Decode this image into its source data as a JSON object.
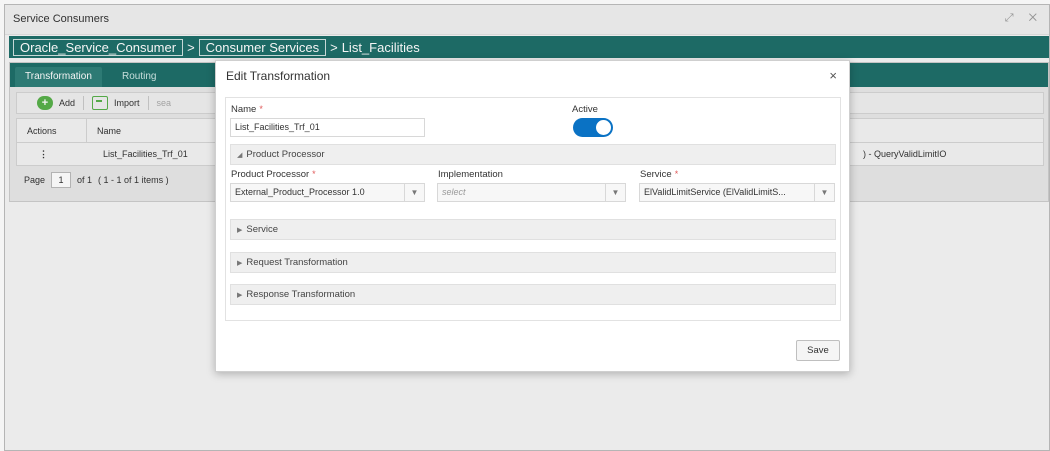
{
  "window": {
    "title": "Service Consumers",
    "controls": "⤢ ✕"
  },
  "breadcrumb": {
    "items": [
      "Oracle_Service_Consumer",
      "Consumer Services",
      "List_Facilities"
    ],
    "separator": ">"
  },
  "tabs": [
    {
      "label": "Transformation",
      "active": true
    },
    {
      "label": "Routing",
      "active": false
    }
  ],
  "toolbar": {
    "add_label": "Add",
    "import_label": "Import",
    "search_stub": "sea"
  },
  "grid": {
    "columns": [
      "Actions",
      "Name"
    ],
    "rows": [
      {
        "actions": "⋮",
        "name": "List_Facilities_Trf_01",
        "trailing": ") - QueryValidLimitIO"
      }
    ]
  },
  "pager": {
    "page_label": "Page",
    "page_value": "1",
    "of_label": "of 1",
    "range_label": "( 1 - 1 of 1 items )"
  },
  "modal": {
    "title": "Edit Transformation",
    "close": "×",
    "name_label": "Name",
    "required_mark": "*",
    "name_value": "List_Facilities_Trf_01",
    "active_label": "Active",
    "active": true,
    "product_processor_section": "Product Processor",
    "product_processor_label": "Product Processor",
    "product_processor_value": "External_Product_Processor 1.0",
    "implementation_label": "Implementation",
    "implementation_placeholder": "select",
    "service_label": "Service",
    "service_value": "ElValidLimitService (ElValidLimitS...",
    "sections": [
      "Service",
      "Request Transformation",
      "Response Transformation"
    ],
    "save_label": "Save"
  },
  "colors": {
    "brand": "#1f6f6a",
    "toggle_on": "#0a72c4",
    "add_green": "#58b04a",
    "required": "#e05a5a"
  }
}
